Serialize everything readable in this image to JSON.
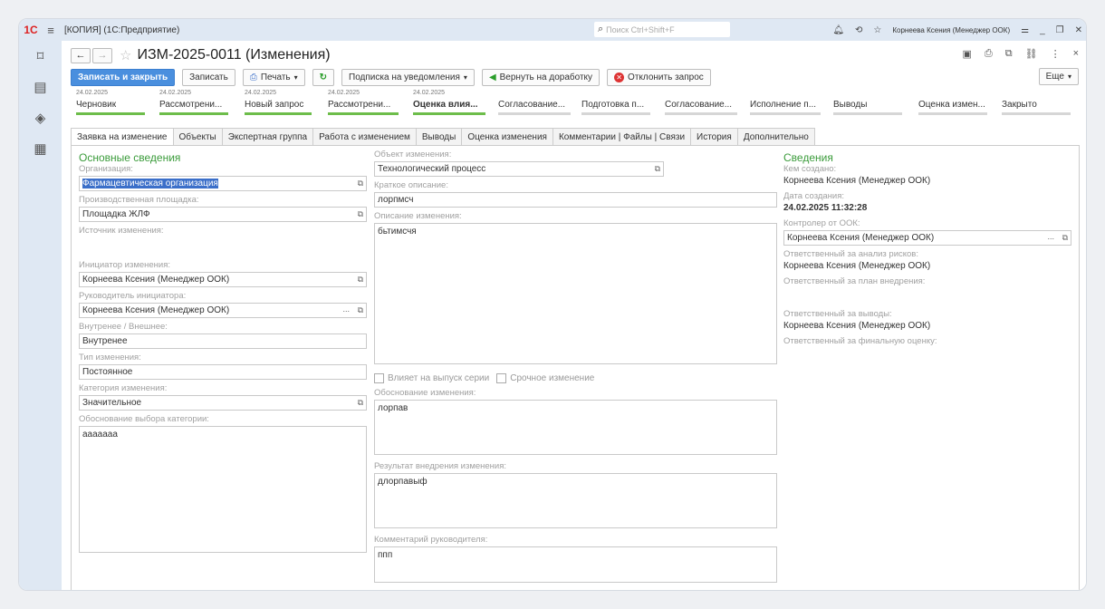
{
  "window": {
    "title": "[КОПИЯ]  (1С:Предприятие)",
    "search_placeholder": "Поиск Ctrl+Shift+F",
    "user": "Корнеева Ксения (Менеджер ООК)"
  },
  "header": {
    "doc_title": "ИЗМ-2025-0011 (Изменения)"
  },
  "toolbar": {
    "save_close": "Записать и закрыть",
    "save": "Записать",
    "print": "Печать",
    "subscribe": "Подписка на уведомления",
    "return": "Вернуть на доработку",
    "reject": "Отклонить запрос",
    "more": "Еще"
  },
  "stages": [
    {
      "date": "24.02.2025",
      "name": "Черновик",
      "status": "done"
    },
    {
      "date": "24.02.2025",
      "name": "Рассмотрени...",
      "status": "done"
    },
    {
      "date": "24.02.2025",
      "name": "Новый запрос",
      "status": "done"
    },
    {
      "date": "24.02.2025",
      "name": "Рассмотрени...",
      "status": "done"
    },
    {
      "date": "24.02.2025",
      "name": "Оценка влия...",
      "status": "active"
    },
    {
      "date": "",
      "name": "Согласование...",
      "status": "pending"
    },
    {
      "date": "",
      "name": "Подготовка п...",
      "status": "pending"
    },
    {
      "date": "",
      "name": "Согласование...",
      "status": "pending"
    },
    {
      "date": "",
      "name": "Исполнение п...",
      "status": "pending"
    },
    {
      "date": "",
      "name": "Выводы",
      "status": "pending"
    },
    {
      "date": "",
      "name": "Оценка измен...",
      "status": "pending"
    },
    {
      "date": "",
      "name": "Закрыто",
      "status": "pending"
    }
  ],
  "tabs": [
    "Заявка на изменение",
    "Объекты",
    "Экспертная группа",
    "Работа с изменением",
    "Выводы",
    "Оценка изменения",
    "Комментарии | Файлы | Связи",
    "История",
    "Дополнительно"
  ],
  "left": {
    "section": "Основные сведения",
    "org_label": "Организация:",
    "org_value": "Фармацевтическая организация",
    "site_label": "Производственная площадка:",
    "site_value": "Площадка ЖЛФ",
    "source_label": "Источник изменения:",
    "initiator_label": "Инициатор изменения:",
    "initiator_value": "Корнеева Ксения (Менеджер ООК)",
    "head_label": "Руководитель инициатора:",
    "head_value": "Корнеева Ксения (Менеджер ООК)",
    "inout_label": "Внутренее / Внешнее:",
    "inout_value": "Внутренее",
    "type_label": "Тип изменения:",
    "type_value": "Постоянное",
    "category_label": "Категория изменения:",
    "category_value": "Значительное",
    "reason_label": "Обоснование выбора категории:",
    "reason_value": "ааааааа"
  },
  "middle": {
    "object_label": "Объект изменения:",
    "object_value": "Технологический процесс",
    "short_label": "Краткое описание:",
    "short_value": "лорпмсч",
    "desc_label": "Описание изменения:",
    "desc_value": "бьтимсчя",
    "affects_batch": "Влияет на выпуск серии",
    "urgent": "Срочное изменение",
    "justif_label": "Обоснование изменения:",
    "justif_value": "лорпав",
    "result_label": "Результат внедрения изменения:",
    "result_value": "длорпавыф",
    "comment_label": "Комментарий руководителя:",
    "comment_value": "ппп"
  },
  "right": {
    "section": "Сведения",
    "created_by_label": "Кем создано:",
    "created_by_value": "Корнеева Ксения (Менеджер ООК)",
    "created_date_label": "Дата создания:",
    "created_date_value": "24.02.2025 11:32:28",
    "controller_label": "Контролер от ООК:",
    "controller_value": "Корнеева Ксения (Менеджер ООК)",
    "risk_label": "Ответственный за анализ рисков:",
    "risk_value": "Корнеева Ксения (Менеджер ООК)",
    "plan_label": "Ответственный за план внедрения:",
    "conclusions_label": "Ответственный за выводы:",
    "conclusions_value": "Корнеева Ксения (Менеджер ООК)",
    "final_label": "Ответственный за финальную оценку:"
  }
}
